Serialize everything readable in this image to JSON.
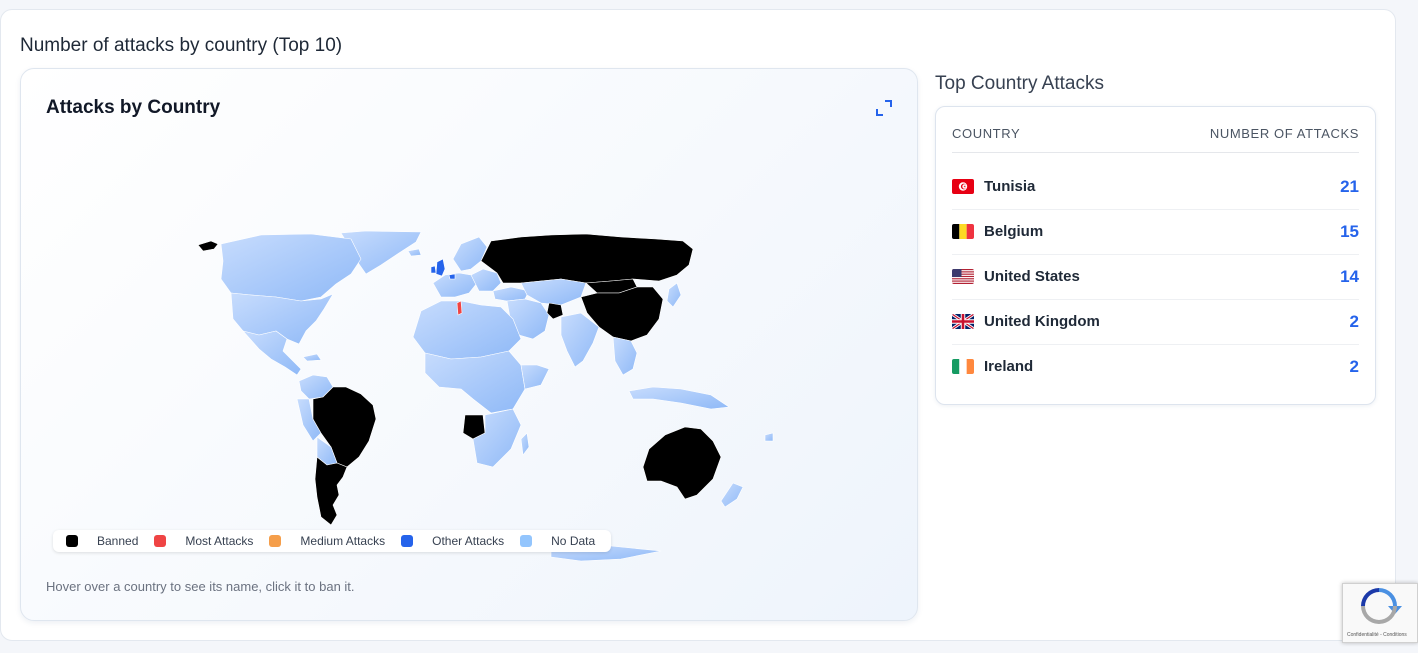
{
  "panel": {
    "title": "Number of attacks by country (Top 10)"
  },
  "map": {
    "title": "Attacks by Country",
    "expand_icon": "expand-icon",
    "hint": "Hover over a country to see its name, click it to ban it.",
    "colors": {
      "banned": "#000000",
      "most": "#ef4444",
      "medium": "#f59e4a",
      "other": "#2563eb",
      "no_data": "#93c5fd"
    },
    "legend": [
      {
        "label": "Banned",
        "color": "#000000"
      },
      {
        "label": "Most Attacks",
        "color": "#ef4444"
      },
      {
        "label": "Medium Attacks",
        "color": "#f59e4a"
      },
      {
        "label": "Other Attacks",
        "color": "#2563eb"
      },
      {
        "label": "No Data",
        "color": "#93c5fd"
      }
    ]
  },
  "top_countries": {
    "title": "Top Country Attacks",
    "col_country": "COUNTRY",
    "col_count": "NUMBER OF ATTACKS",
    "rows": [
      {
        "country": "Tunisia",
        "count": "21"
      },
      {
        "country": "Belgium",
        "count": "15"
      },
      {
        "country": "United States",
        "count": "14"
      },
      {
        "country": "United Kingdom",
        "count": "2"
      },
      {
        "country": "Ireland",
        "count": "2"
      }
    ]
  },
  "recaptcha": {
    "text": "Confidentialité - Conditions",
    "icon": "recaptcha-icon"
  }
}
